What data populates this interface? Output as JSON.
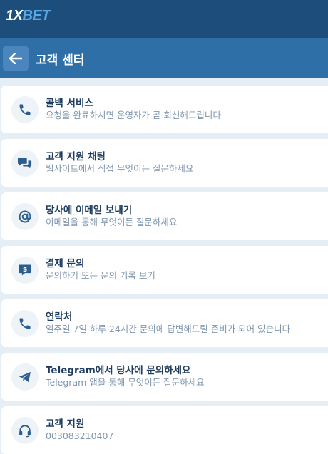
{
  "brand": {
    "logo_a": "1X",
    "logo_b": "BET"
  },
  "header": {
    "title": "고객 센터"
  },
  "items": [
    {
      "icon": "phone-icon",
      "title": "콜백 서비스",
      "subtitle": "요청을 완료하시면 운영자가 곧 회신해드립니다"
    },
    {
      "icon": "chat-icon",
      "title": "고객 지원 채팅",
      "subtitle": "웹사이트에서 직접 무엇이든 질문하세요"
    },
    {
      "icon": "at-icon",
      "title": "당사에 이메일 보내기",
      "subtitle": "이메일을 통해 무엇이든 질문하세요"
    },
    {
      "icon": "payment-chat-icon",
      "title": "결제 문의",
      "subtitle": "문의하기 또는 문의 기록 보기"
    },
    {
      "icon": "phone-icon",
      "title": "연락처",
      "subtitle": "일주일 7일 하루 24시간 문의에 답변해드릴 준비가 되어 있습니다"
    },
    {
      "icon": "telegram-icon",
      "title": "Telegram에서 당사에 문의하세요",
      "subtitle": "Telegram 앱을 통해 무엇이든 질문하세요"
    },
    {
      "icon": "headset-icon",
      "title": "고객 지원",
      "subtitle": "003083210407"
    }
  ],
  "colors": {
    "topbar": "#1d4d7a",
    "header": "#2e6fa8",
    "icon": "#2c5d8f",
    "logo_accent": "#5aa9e6"
  }
}
